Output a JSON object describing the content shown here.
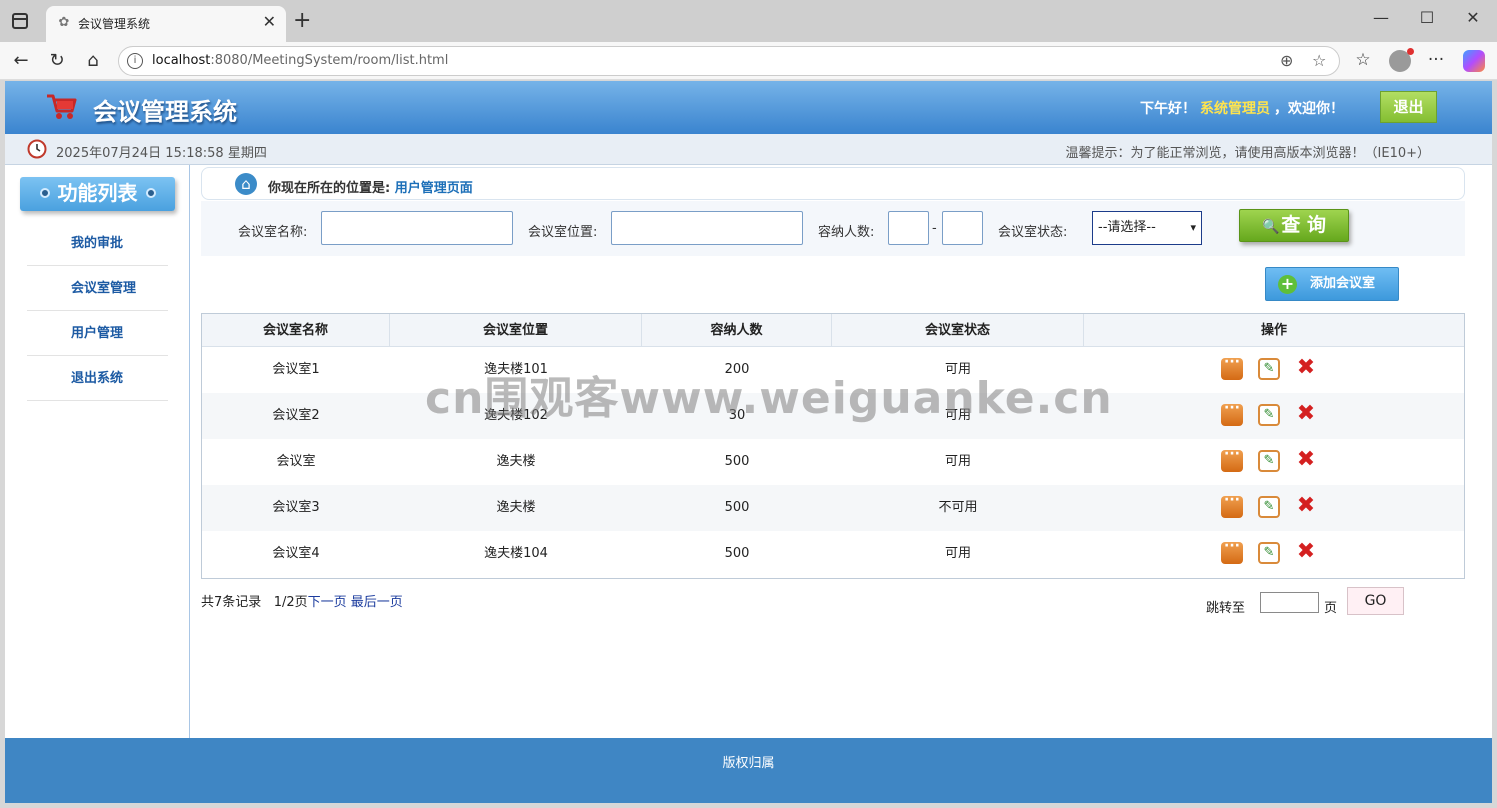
{
  "browser": {
    "tab_title": "会议管理系统",
    "url_host": "localhost",
    "url_path": ":8080/MeetingSystem/room/list.html"
  },
  "header": {
    "title": "会议管理系统",
    "greeting": "下午好！",
    "user": "系统管理员",
    "welcome_suffix": "，欢迎你！",
    "logout": "退出"
  },
  "infobar": {
    "datetime": "2025年07月24日 15:18:58 星期四",
    "tip": "温馨提示：为了能正常浏览，请使用高版本浏览器！（IE10+）"
  },
  "sidebar": {
    "title": "功能列表",
    "items": [
      {
        "label": "我的审批"
      },
      {
        "label": "会议室管理"
      },
      {
        "label": "用户管理"
      },
      {
        "label": "退出系统"
      }
    ]
  },
  "location": {
    "label": "你现在所在的位置是:",
    "current": "用户管理页面"
  },
  "search": {
    "name_label": "会议室名称:",
    "location_label": "会议室位置:",
    "capacity_label": "容纳人数:",
    "dash": "-",
    "status_label": "会议室状态:",
    "status_selected": "--请选择--",
    "query": "查 询"
  },
  "add_button": "添加会议室",
  "table": {
    "headers": [
      "会议室名称",
      "会议室位置",
      "容纳人数",
      "会议室状态",
      "操作"
    ],
    "rows": [
      {
        "name": "会议室1",
        "location": "逸夫楼101",
        "capacity": "200",
        "status": "可用"
      },
      {
        "name": "会议室2",
        "location": "逸夫楼102",
        "capacity": "30",
        "status": "可用"
      },
      {
        "name": "会议室",
        "location": "逸夫楼",
        "capacity": "500",
        "status": "可用"
      },
      {
        "name": "会议室3",
        "location": "逸夫楼",
        "capacity": "500",
        "status": "不可用"
      },
      {
        "name": "会议室4",
        "location": "逸夫楼104",
        "capacity": "500",
        "status": "可用"
      }
    ]
  },
  "pager": {
    "total": "共7条记录",
    "page": "1/2页",
    "next": "下一页",
    "last": "最后一页",
    "jump_label": "跳转至",
    "page_unit": "页",
    "go": "GO"
  },
  "footer": {
    "copyright": "版权归属"
  },
  "watermark": "cn围观客www.weiguanke.cn",
  "colors": {
    "header_blue": "#3a84cf",
    "footer_blue": "#3f86c4",
    "logout_green": "#84be32",
    "query_green": "#66a81d",
    "link_blue": "#1c5aa3",
    "admin_yellow": "#ffe44d"
  }
}
